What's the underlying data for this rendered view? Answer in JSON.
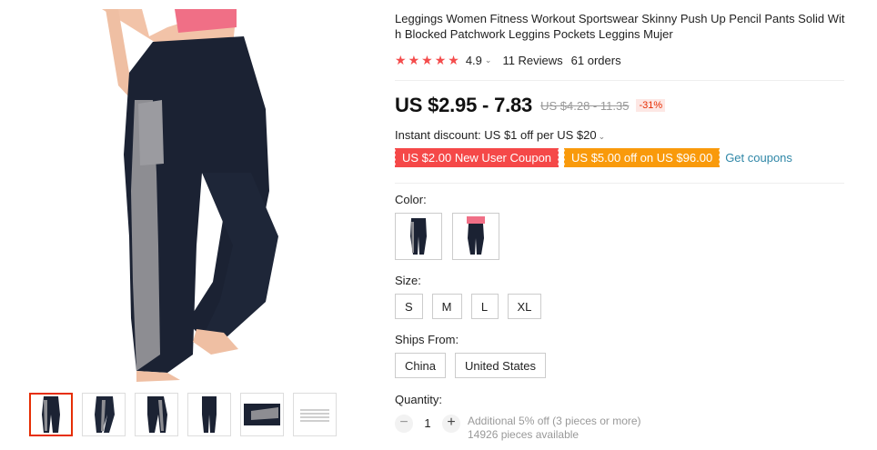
{
  "product": {
    "title": "Leggings Women Fitness Workout Sportswear Skinny Push Up Pencil Pants Solid With Blocked Patchwork Leggins Pockets Leggins Mujer",
    "rating": "4.9",
    "reviews": "11 Reviews",
    "orders": "61 orders",
    "stars_filled": 5
  },
  "price": {
    "range": "US $2.95 - 7.83",
    "original": "US $4.28 - 11.35",
    "discount": "-31%"
  },
  "instant_discount": "Instant discount: US $1 off per US $20",
  "coupons": {
    "new_user": "US $2.00 New User Coupon",
    "store": "US $5.00 off on US $96.00",
    "get_link": "Get coupons"
  },
  "color": {
    "label": "Color:",
    "options": [
      "black-legging-thumbnail",
      "pink-top-legging-thumbnail"
    ]
  },
  "size": {
    "label": "Size:",
    "options": [
      "S",
      "M",
      "L",
      "XL"
    ]
  },
  "ships_from": {
    "label": "Ships From:",
    "options": [
      "China",
      "United States"
    ]
  },
  "quantity": {
    "label": "Quantity:",
    "value": "1",
    "minus": "−",
    "plus": "+",
    "bulk_note": "Additional 5% off (3 pieces or more)",
    "available": "14926 pieces available"
  },
  "colors": {
    "accent_red": "#f54848",
    "accent_orange": "#f99a0b",
    "link_blue": "#2f87a7",
    "star_red": "#f44c4c"
  }
}
